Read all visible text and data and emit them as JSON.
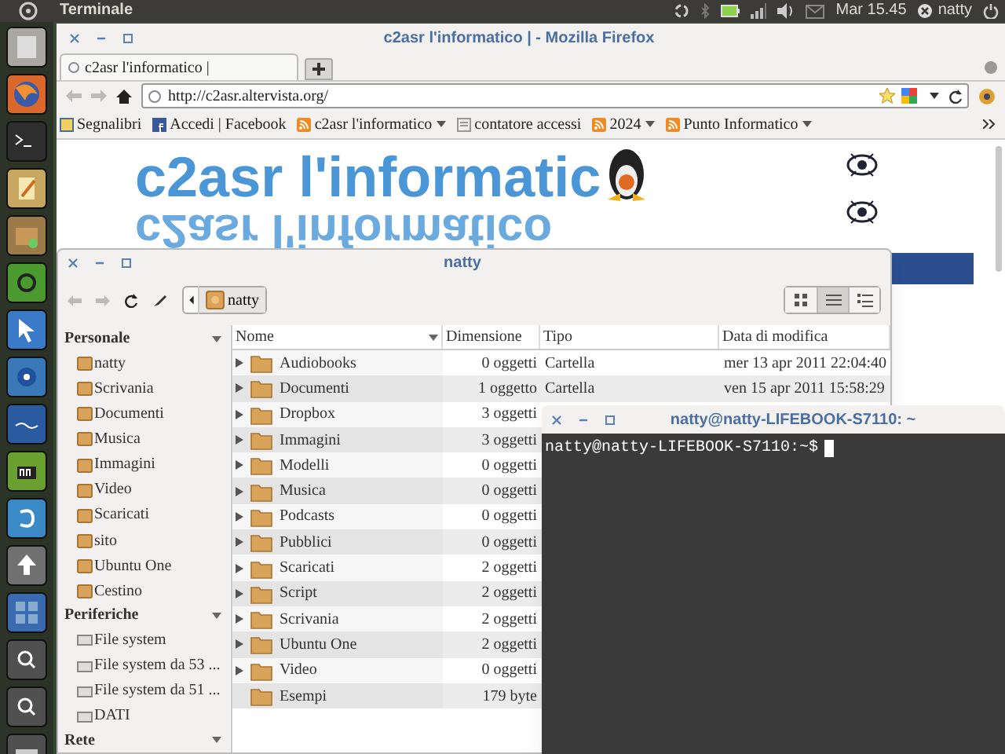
{
  "top_panel": {
    "app_title": "Terminale",
    "clock": "Mar 15.45",
    "user": "natty"
  },
  "firefox": {
    "title": "c2asr l'informatico | - Mozilla Firefox",
    "tabs": [
      {
        "label": "c2asr l'informatico |",
        "selected": true
      }
    ],
    "url": "http://c2asr.altervista.org/",
    "bookmarks": [
      {
        "label": "Segnalibri",
        "kind": "star",
        "menu": false
      },
      {
        "label": "Accedi | Facebook",
        "kind": "facebook",
        "menu": false
      },
      {
        "label": "c2asr l'informatico",
        "kind": "feed",
        "menu": true
      },
      {
        "label": "contatore accessi",
        "kind": "page",
        "menu": false
      },
      {
        "label": "2024",
        "kind": "feed",
        "menu": true
      },
      {
        "label": "Punto Informatico",
        "kind": "feed",
        "menu": true
      }
    ],
    "site_title": "c2asr l'informatic",
    "site_title_reflection": "c2asr l'informatico"
  },
  "file_manager": {
    "title": "natty",
    "path": [
      {
        "label": "natty",
        "selected": true
      }
    ],
    "view_modes": [
      {
        "kind": "icons",
        "selected": false
      },
      {
        "kind": "compact",
        "selected": true
      },
      {
        "kind": "list",
        "selected": false
      }
    ],
    "sidebar": [
      {
        "title": "Personale",
        "items": [
          {
            "label": "natty"
          },
          {
            "label": "Scrivania"
          },
          {
            "label": "Documenti"
          },
          {
            "label": "Musica"
          },
          {
            "label": "Immagini"
          },
          {
            "label": "Video"
          },
          {
            "label": "Scaricati"
          },
          {
            "label": "sito"
          },
          {
            "label": "Ubuntu One"
          },
          {
            "label": "Cestino"
          }
        ]
      },
      {
        "title": "Periferiche",
        "items": [
          {
            "label": "File system"
          },
          {
            "label": "File system da 53 ..."
          },
          {
            "label": "File system da 51 ..."
          },
          {
            "label": "DATI"
          }
        ]
      },
      {
        "title": "Rete"
      }
    ],
    "columns": [
      "Nome",
      "Dimensione",
      "Tipo",
      "Data di modifica"
    ],
    "rows": [
      {
        "name": "Audiobooks",
        "size": "0 oggetti",
        "type": "Cartella",
        "modified": "mer 13 apr 2011 22:04:40",
        "expandable": true
      },
      {
        "name": "Documenti",
        "size": "1 oggetto",
        "type": "Cartella",
        "modified": "ven 15 apr 2011 15:58:29",
        "expandable": true
      },
      {
        "name": "Dropbox",
        "size": "3 oggetti",
        "expandable": true
      },
      {
        "name": "Immagini",
        "size": "3 oggetti",
        "expandable": true
      },
      {
        "name": "Modelli",
        "size": "0 oggetti",
        "expandable": true
      },
      {
        "name": "Musica",
        "size": "0 oggetti",
        "expandable": true
      },
      {
        "name": "Podcasts",
        "size": "0 oggetti",
        "expandable": true
      },
      {
        "name": "Pubblici",
        "size": "0 oggetti",
        "expandable": true
      },
      {
        "name": "Scaricati",
        "size": "2 oggetti",
        "expandable": true
      },
      {
        "name": "Script",
        "size": "2 oggetti",
        "expandable": true
      },
      {
        "name": "Scrivania",
        "size": "2 oggetti",
        "expandable": true
      },
      {
        "name": "Ubuntu One",
        "size": "2 oggetti",
        "expandable": true
      },
      {
        "name": "Video",
        "size": "0 oggetti",
        "expandable": true
      },
      {
        "name": "Esempi",
        "size": "179 byte",
        "expandable": false
      }
    ]
  },
  "terminal": {
    "title": "natty@natty-LIFEBOOK-S7110: ~",
    "prompt": "natty@natty-LIFEBOOK-S7110:~$"
  }
}
